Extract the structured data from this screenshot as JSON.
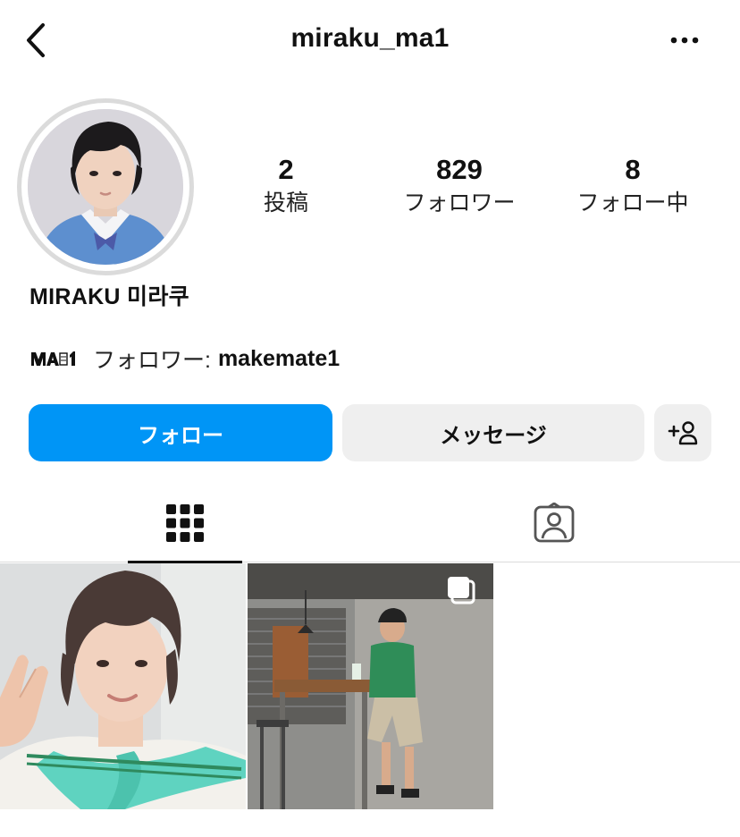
{
  "header": {
    "username": "miraku_ma1",
    "back_icon": "chevron-left-icon",
    "more_icon": "more-horizontal-icon"
  },
  "profile": {
    "display_name": "MIRAKU 미라쿠",
    "stats": [
      {
        "value": "2",
        "label": "投稿"
      },
      {
        "value": "829",
        "label": "フォロワー"
      },
      {
        "value": "8",
        "label": "フォロー中"
      }
    ],
    "followed_by": {
      "label": "フォロワー:",
      "user": "makemate1",
      "logo_text": "MA1"
    }
  },
  "actions": {
    "follow_label": "フォロー",
    "message_label": "メッセージ",
    "add_user_icon": "add-user-icon"
  },
  "tabs": {
    "grid_icon": "grid-icon",
    "tagged_icon": "tagged-user-icon"
  },
  "colors": {
    "follow_button": "#0095f6",
    "secondary_button": "#efefef",
    "avatar_ring": "#dbdbdb",
    "divider": "#dbdbdb"
  }
}
